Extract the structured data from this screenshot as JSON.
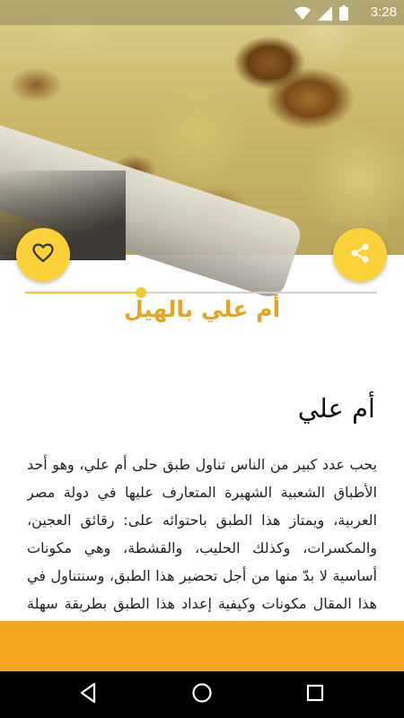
{
  "status_bar": {
    "time": "3:28",
    "icons": [
      "wifi-icon",
      "signal-icon",
      "battery-icon"
    ]
  },
  "hero": {
    "image": "om-ali-dish-photo"
  },
  "actions": {
    "favorite_icon": "heart-outline-icon",
    "share_icon": "share-icon"
  },
  "recipe": {
    "title": "أم علي بالهيل",
    "scroll_progress": 0.33
  },
  "article": {
    "heading": "أم علي",
    "body": "يحب عدد كبير من الناس تناول طبق حلى أم علي، وهو أحد الأطباق الشعبية الشهيرة المتعارف عليها في دولة مصر العربية، ويمتاز هذا الطبق باحتوائه على: رقائق العجين، والمكسرات، وكذلك الحليب، والقشطة، وهي مكونات أساسية لا بدّ منها من أجل تحضير هذا الطبق، وسنتناول في هذا المقال مكونات وكيفية إعداد هذا الطبق بطريقة سهلة وبسيطة."
  },
  "colors": {
    "accent_yellow": "#fdd13a",
    "title_orange": "#e4a424",
    "banner_orange": "#f4a51f"
  },
  "nav": {
    "back_icon": "back-triangle-icon",
    "home_icon": "home-circle-icon",
    "recent_icon": "recent-apps-square-icon"
  }
}
